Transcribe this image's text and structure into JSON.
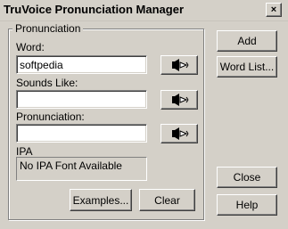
{
  "window": {
    "title": "TruVoice Pronunciation Manager",
    "close_glyph": "×"
  },
  "group": {
    "legend": "Pronunciation"
  },
  "word": {
    "label": "Word:",
    "value": "softpedia"
  },
  "sounds_like": {
    "label": "Sounds Like:",
    "value": ""
  },
  "pronunciation": {
    "label": "Pronunciation:",
    "value": ""
  },
  "ipa": {
    "label": "IPA",
    "value": "No IPA Font Available"
  },
  "buttons": {
    "examples": "Examples...",
    "clear": "Clear",
    "add": "Add",
    "word_list": "Word List...",
    "close": "Close",
    "help": "Help"
  },
  "icons": {
    "speak": "speaker-play-icon"
  }
}
